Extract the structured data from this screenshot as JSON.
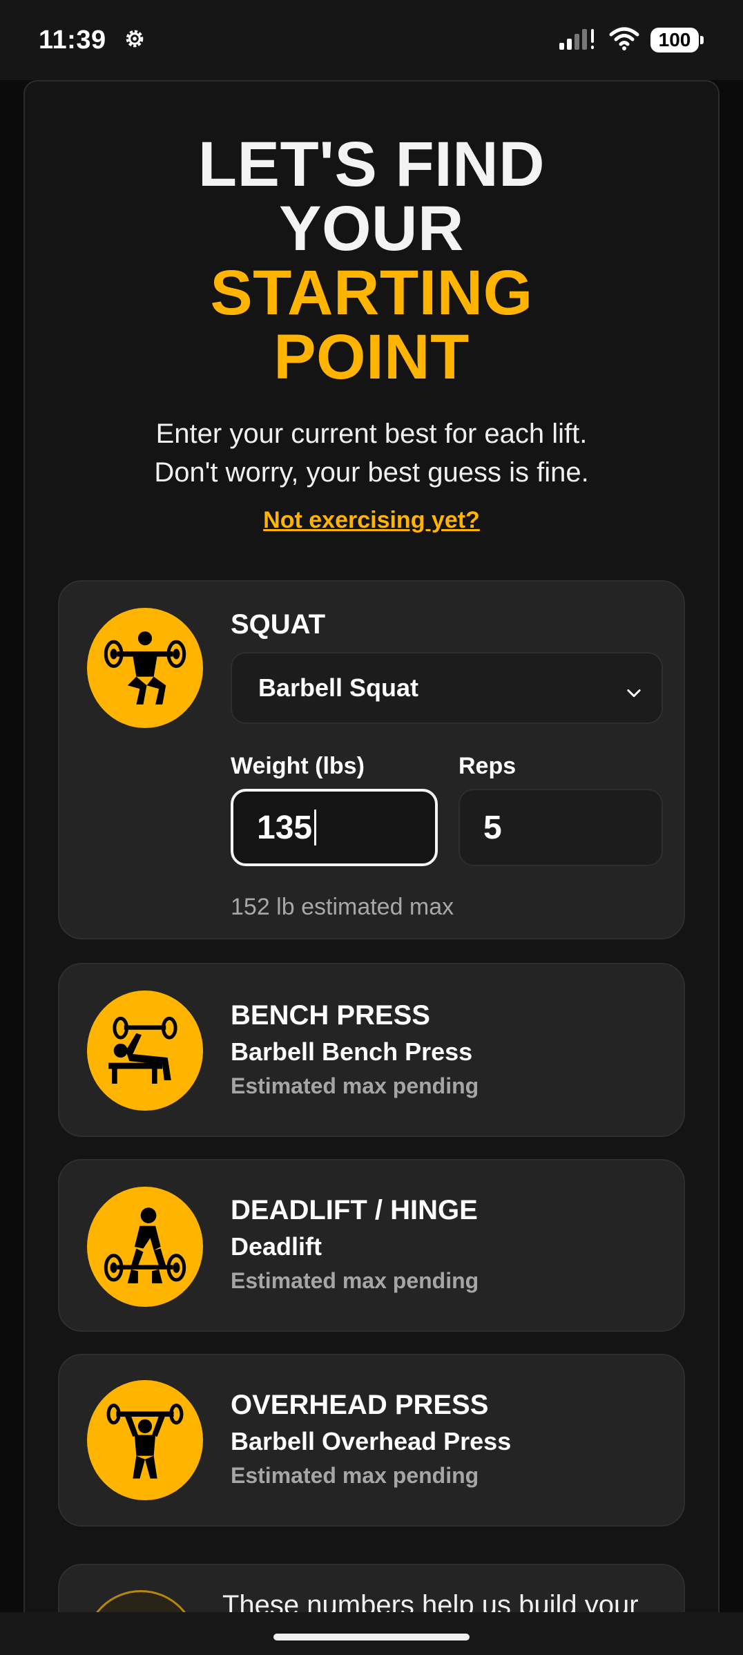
{
  "status_bar": {
    "time": "11:39",
    "battery": "100",
    "icons": [
      "gear-icon",
      "signal-icon",
      "wifi-icon",
      "battery-icon"
    ]
  },
  "hero": {
    "line1": "LET'S FIND",
    "line2": "YOUR",
    "line3": "STARTING",
    "line4": "POINT"
  },
  "subtitle": {
    "line1": "Enter your current best for each lift.",
    "line2": "Don't worry, your best guess is fine."
  },
  "link": "Not exercising yet?",
  "colors": {
    "accent": "#ffb400",
    "background": "#141414",
    "card": "#242424"
  },
  "squat": {
    "title": "SQUAT",
    "exercise": "Barbell Squat",
    "weight_label": "Weight (lbs)",
    "reps_label": "Reps",
    "weight_value": "135",
    "reps_value": "5",
    "estimate": "152 lb estimated max",
    "icon": "squat-icon"
  },
  "lifts": [
    {
      "title": "BENCH PRESS",
      "exercise": "Barbell Bench Press",
      "status": "Estimated max pending",
      "icon": "bench-press-icon"
    },
    {
      "title": "DEADLIFT / HINGE",
      "exercise": "Deadlift",
      "status": "Estimated max pending",
      "icon": "deadlift-icon"
    },
    {
      "title": "OVERHEAD PRESS",
      "exercise": "Barbell Overhead Press",
      "status": "Estimated max pending",
      "icon": "overhead-press-icon"
    }
  ],
  "bottom_note": "These numbers help us build your"
}
